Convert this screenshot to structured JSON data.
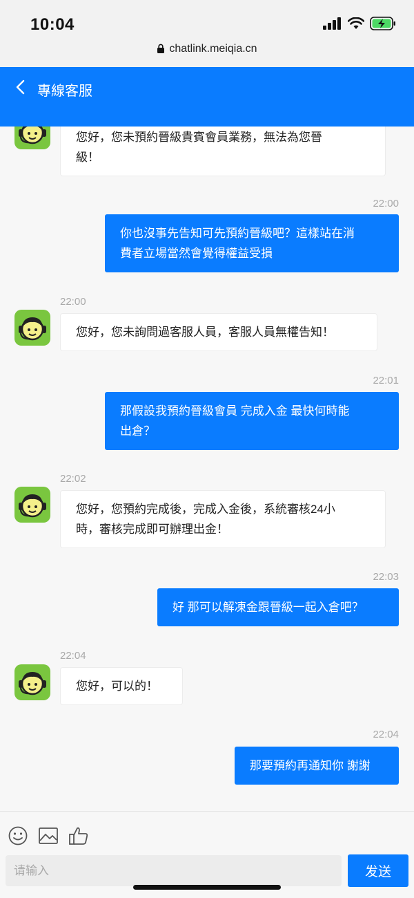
{
  "status_bar": {
    "time": "10:04"
  },
  "browser": {
    "url": "chatlink.meiqia.cn"
  },
  "header": {
    "title": "專線客服"
  },
  "messages": [
    {
      "side": "agent",
      "time": "",
      "lines": [
        "您好，您未預約晉級貴賓會員業務，無法為您晉",
        "級！"
      ]
    },
    {
      "side": "user",
      "time": "22:00",
      "lines": [
        "你也沒事先告知可先預約晉級吧？這樣站在消",
        "費者立場當然會覺得權益受損"
      ]
    },
    {
      "side": "agent",
      "time": "22:00",
      "lines": [
        "您好，您未詢問過客服人員，客服人員無權告知！"
      ]
    },
    {
      "side": "user",
      "time": "22:01",
      "lines": [
        "那假設我預約晉級會員 完成入金 最快何時能",
        "出倉？"
      ]
    },
    {
      "side": "agent",
      "time": "22:02",
      "lines": [
        "您好，您預約完成後，完成入金後，系統審核24小",
        "時，審核完成即可辦理出金！"
      ]
    },
    {
      "side": "user",
      "time": "22:03",
      "lines": [
        "好 那可以解凍金跟晉級一起入倉吧？"
      ]
    },
    {
      "side": "agent",
      "time": "22:04",
      "lines": [
        "您好，可以的！"
      ]
    },
    {
      "side": "user",
      "time": "22:04",
      "lines": [
        "那要預約再通知你 謝謝"
      ]
    }
  ],
  "composer": {
    "placeholder": "请输入",
    "send_label": "发送"
  },
  "icons": {
    "toolbar": [
      "emoji-icon",
      "image-icon",
      "thumbs-up-icon"
    ]
  },
  "colors": {
    "accent": "#0a7cff",
    "avatar_bg": "#7ac63f"
  }
}
